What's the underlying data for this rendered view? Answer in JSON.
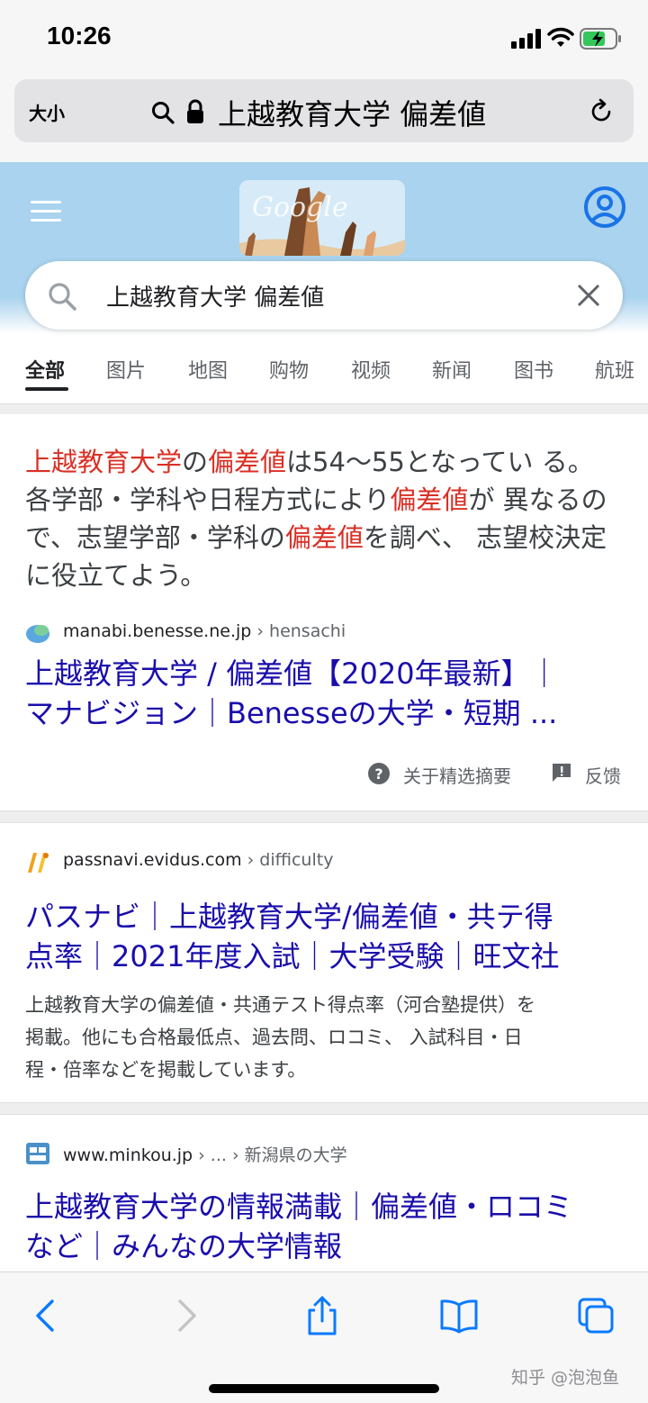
{
  "status_bar": {
    "time": "10:26"
  },
  "url_bar": {
    "text_size_label": "大小",
    "address_text": "上越教育大学 偏差値"
  },
  "google": {
    "search_query": "上越教育大学 偏差値",
    "tabs": [
      {
        "label": "全部",
        "active": true
      },
      {
        "label": "图片"
      },
      {
        "label": "地图"
      },
      {
        "label": "购物"
      },
      {
        "label": "视频"
      },
      {
        "label": "新闻"
      },
      {
        "label": "图书"
      },
      {
        "label": "航班"
      }
    ]
  },
  "featured_snippet": {
    "text_parts": [
      {
        "t": "上越教育大学",
        "hl": true
      },
      {
        "t": "の",
        "hl": false
      },
      {
        "t": "偏差値",
        "hl": true
      },
      {
        "t": "は54～55となってい る。 各学部・学科や日程方式により",
        "hl": false
      },
      {
        "t": "偏差値",
        "hl": true
      },
      {
        "t": "が 異なるので、志望学部・学科の",
        "hl": false
      },
      {
        "t": "偏差値",
        "hl": true
      },
      {
        "t": "を調べ、 志望校決定に役立てよう。",
        "hl": false
      }
    ],
    "site": "manabi.benesse.ne.jp",
    "path": " › hensachi",
    "title_line1": "上越教育大学 / 偏差値【2020年最新】｜",
    "title_line2": "マナビジョン｜Benesseの大学・短期 ...",
    "about_label": "关于精选摘要",
    "feedback_label": "反馈"
  },
  "results": [
    {
      "site": "passnavi.evidus.com",
      "path": " › difficulty",
      "title_line1": "パスナビ｜上越教育大学/偏差値・共テ得",
      "title_line2": "点率｜2021年度入試｜大学受験｜旺文社",
      "desc_line1": "上越教育大学の偏差値・共通テスト得点率（河合塾提供）を",
      "desc_line2": "掲載。他にも合格最低点、過去問、ロコミ、 入試科目・日",
      "desc_line3": "程・倍率などを掲載しています。"
    },
    {
      "site": "www.minkou.jp",
      "path": " › ... › 新潟県の大学",
      "title_line1": "上越教育大学の情報満載｜偏差値・ロコミ",
      "title_line2": "など｜みんなの大学情報"
    }
  ],
  "watermark": "知乎 @泡泡鱼",
  "colors": {
    "link": "#1a0dab",
    "highlight": "#d93025",
    "ios_blue": "#0a7aff",
    "header_blue": "#a9d3ee"
  }
}
